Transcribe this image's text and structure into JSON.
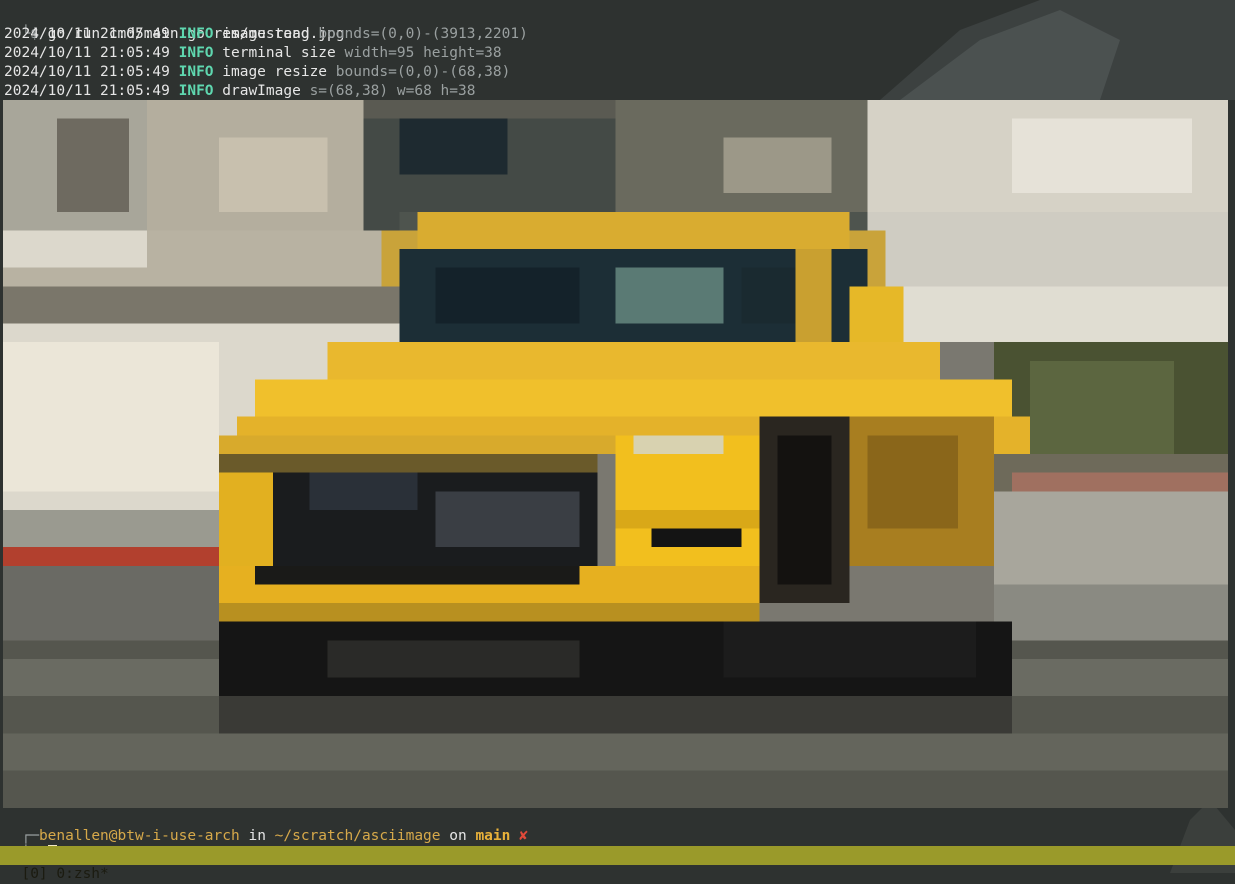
{
  "terminal": {
    "command_prompt": "└$",
    "command": "go run cmd/main.go res/mustang.jpg",
    "log": [
      {
        "ts": "2024/10/11 21:05:49",
        "level": "INFO",
        "msg": "image read",
        "kv": "bounds=(0,0)-(3913,2201)"
      },
      {
        "ts": "2024/10/11 21:05:49",
        "level": "INFO",
        "msg": "terminal size",
        "kv": "width=95 height=38"
      },
      {
        "ts": "2024/10/11 21:05:49",
        "level": "INFO",
        "msg": "image resize",
        "kv": "bounds=(0,0)-(68,38)"
      },
      {
        "ts": "2024/10/11 21:05:49",
        "level": "INFO",
        "msg": "drawImage",
        "kv": "s=(68,38) w=68 h=38"
      }
    ],
    "prompt": {
      "corner": "┌─",
      "user": "benallen@btw-i-use-arch",
      "in": " in ",
      "path": "~/scratch/asciimage",
      "on": " on ",
      "branch": "main",
      "dirty": "✘",
      "second_prefix": "└$ "
    },
    "status_bar": "[0] 0:zsh*"
  },
  "colors": {
    "background": "#2e3230",
    "info": "#5fd7af",
    "branch": "#e8b13a",
    "dirty": "#e04a3a",
    "status_bar": "#9a9a2a"
  }
}
